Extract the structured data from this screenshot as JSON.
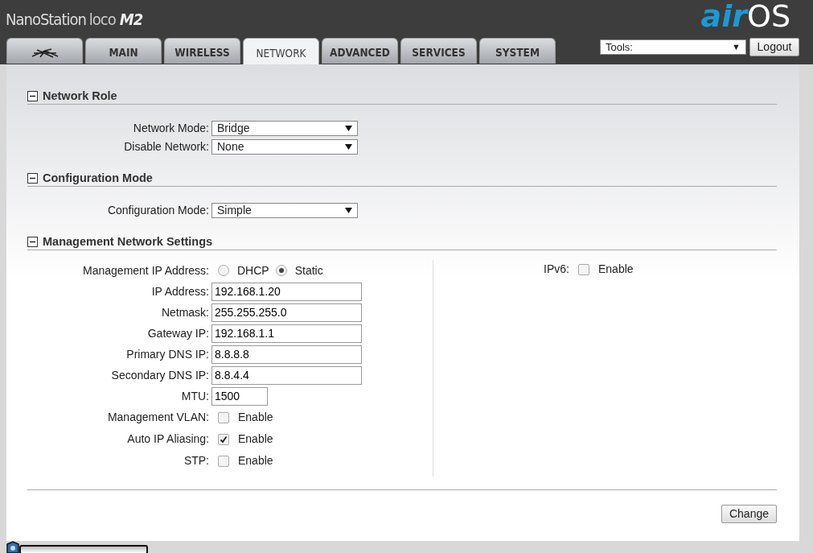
{
  "header": {
    "product": "NanoStation",
    "model": "loco",
    "suffix": "M2",
    "brand_a": "air",
    "brand_b": "OS"
  },
  "tabs": [
    {
      "kind": "icon",
      "selected": false
    },
    {
      "kind": "text",
      "label": "MAIN",
      "selected": false
    },
    {
      "kind": "text",
      "label": "WIRELESS",
      "selected": false
    },
    {
      "kind": "text",
      "label": "NETWORK",
      "selected": true
    },
    {
      "kind": "text",
      "label": "ADVANCED",
      "selected": false
    },
    {
      "kind": "text",
      "label": "SERVICES",
      "selected": false
    },
    {
      "kind": "text",
      "label": "SYSTEM",
      "selected": false
    }
  ],
  "tools": {
    "value": "Tools:",
    "caret": "▼"
  },
  "logout": "Logout",
  "sections": [
    {
      "title": "Network Role",
      "expanded": true,
      "rows": [
        {
          "kind": "select",
          "label": "Network Mode:",
          "value": "Bridge"
        },
        {
          "kind": "select",
          "label": "Disable Network:",
          "value": "None"
        }
      ]
    },
    {
      "title": "Configuration Mode",
      "expanded": true,
      "rows": [
        {
          "kind": "select",
          "label": "Configuration Mode:",
          "value": "Simple"
        }
      ]
    },
    {
      "title": "Management Network Settings",
      "expanded": true,
      "rows": [
        {
          "kind": "radio",
          "label": "Management IP Address:",
          "options": [
            {
              "label": "DHCP",
              "selected": false
            },
            {
              "label": "Static",
              "selected": true
            }
          ]
        },
        {
          "kind": "text",
          "label": "IP Address:",
          "value": "192.168.1.20"
        },
        {
          "kind": "text",
          "label": "Netmask:",
          "value": "255.255.255.0"
        },
        {
          "kind": "text",
          "label": "Gateway IP:",
          "value": "192.168.1.1"
        },
        {
          "kind": "text",
          "label": "Primary DNS IP:",
          "value": "8.8.8.8"
        },
        {
          "kind": "text",
          "label": "Secondary DNS IP:",
          "value": "8.8.4.4"
        },
        {
          "kind": "short",
          "label": "MTU:",
          "value": "1500"
        },
        {
          "kind": "checkbox",
          "label": "Management VLAN:",
          "option": "Enable",
          "checked": false
        },
        {
          "kind": "checkbox",
          "label": "Auto IP Aliasing:",
          "option": "Enable",
          "checked": true
        },
        {
          "kind": "checkbox",
          "label": "STP:",
          "option": "Enable",
          "checked": false
        }
      ],
      "side_rows": [
        {
          "kind": "checkbox",
          "label": "IPv6:",
          "option": "Enable",
          "checked": false
        }
      ]
    }
  ],
  "change": "Change"
}
